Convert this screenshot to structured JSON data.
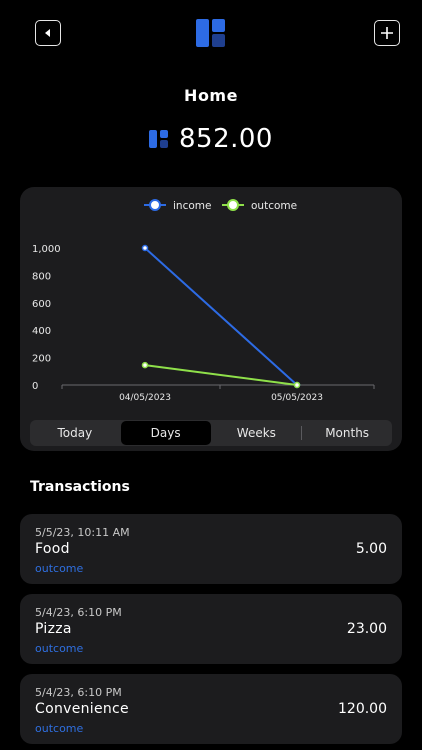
{
  "header": {
    "back_icon": "chevron-left-icon",
    "add_icon": "plus-icon",
    "logo_icon": "app-logo-icon"
  },
  "page": {
    "title": "Home",
    "balance": "852.00",
    "balance_icon": "wallet-blocks-icon"
  },
  "colors": {
    "accent": "#2d6be4",
    "accent_dark": "#1f3f8f",
    "income": "#2d6be4",
    "outcome": "#8fe04a",
    "card": "#1c1c1e"
  },
  "chart_data": {
    "type": "line",
    "x": [
      "04/05/2023",
      "05/05/2023"
    ],
    "series": [
      {
        "name": "income",
        "values": [
          1000,
          0
        ]
      },
      {
        "name": "outcome",
        "values": [
          145,
          0
        ]
      }
    ],
    "yticks": [
      "1,000",
      "800",
      "600",
      "400",
      "200",
      "0"
    ],
    "ylim": [
      0,
      1000
    ],
    "legend": "top-center",
    "grid": false
  },
  "periods": {
    "items": [
      "Today",
      "Days",
      "Weeks",
      "Months"
    ],
    "selected": "Days"
  },
  "transactions": {
    "title": "Transactions",
    "items": [
      {
        "date": "5/5/23, 10:11 AM",
        "name": "Food",
        "type": "outcome",
        "amount": "5.00"
      },
      {
        "date": "5/4/23, 6:10 PM",
        "name": "Pizza",
        "type": "outcome",
        "amount": "23.00"
      },
      {
        "date": "5/4/23, 6:10 PM",
        "name": "Convenience",
        "type": "outcome",
        "amount": "120.00"
      }
    ]
  }
}
